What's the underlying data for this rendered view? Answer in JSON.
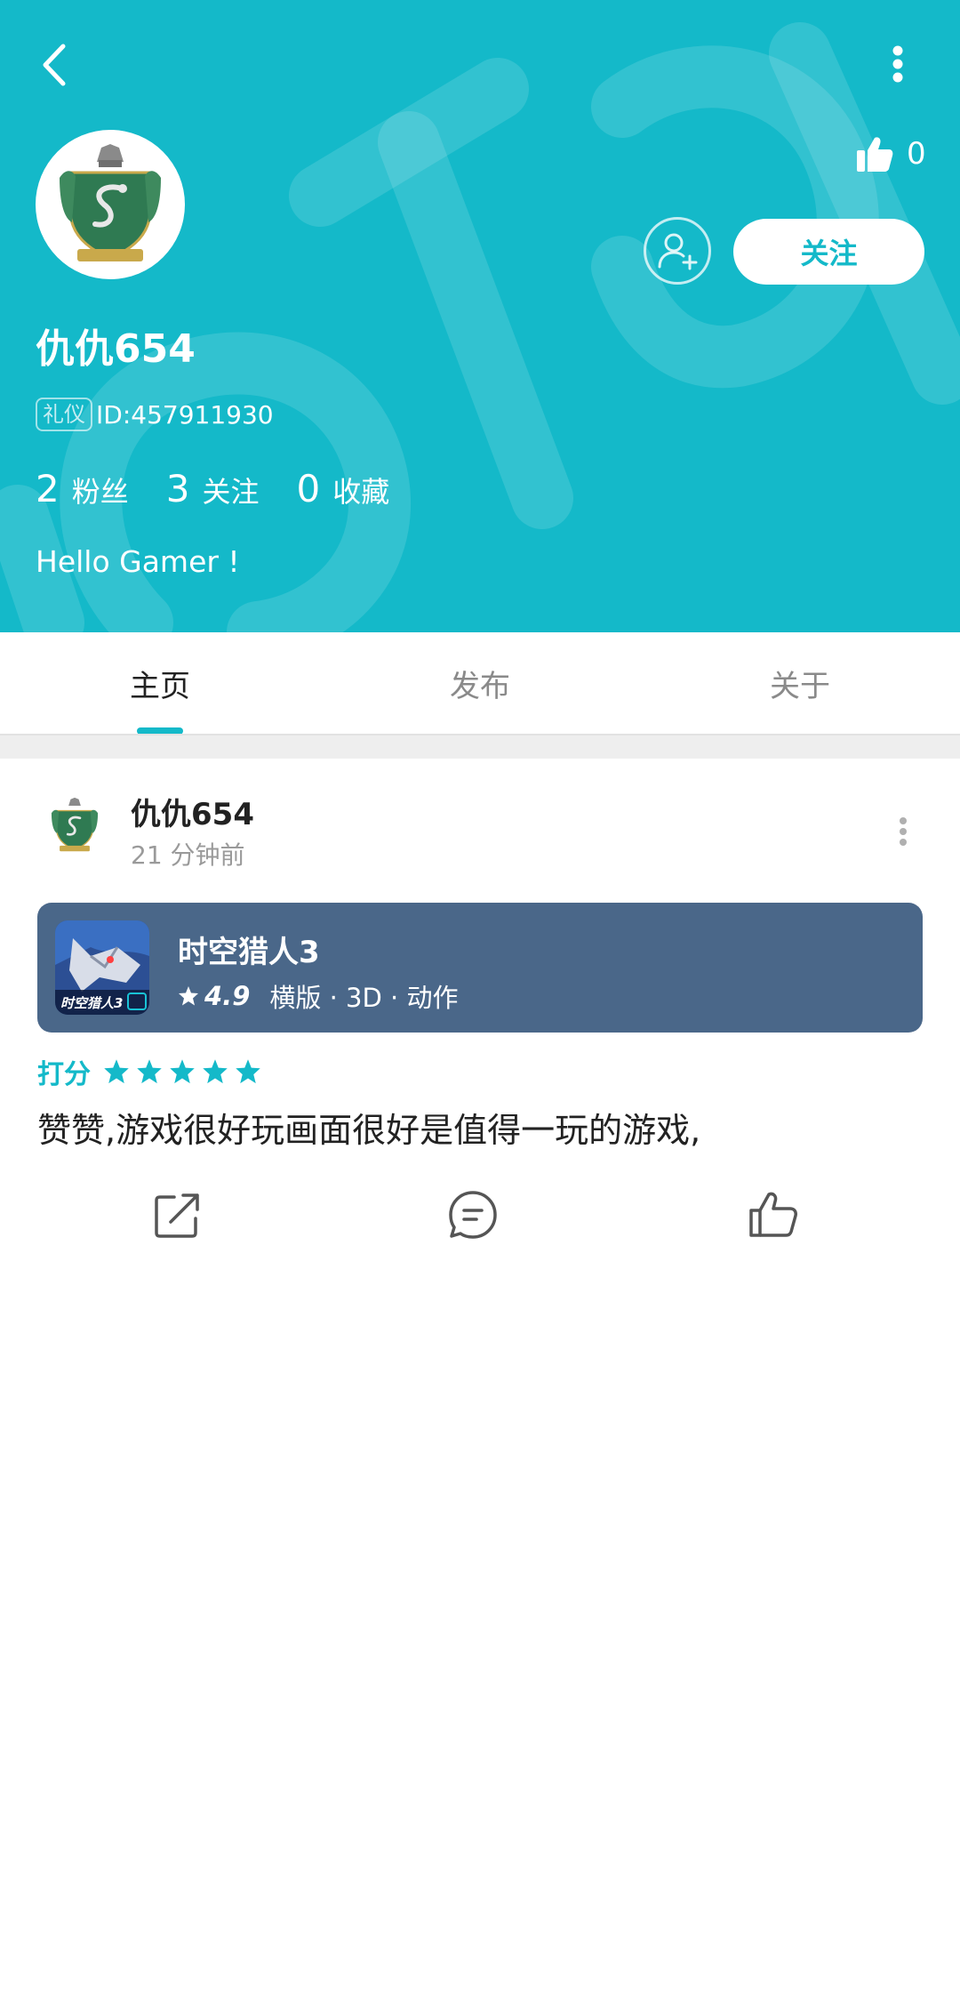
{
  "header": {
    "back_icon": "chevron-left-icon",
    "more_icon": "vertical-dots-icon",
    "like_icon": "thumbs-up-filled-icon",
    "like_count": "0",
    "avatar_icon": "house-crest-icon",
    "add_friend_icon": "add-user-icon",
    "follow_label": "关注",
    "username": "仇仇654",
    "badge": "礼仪",
    "user_id": "ID:457911930",
    "stats": [
      {
        "num": "2",
        "label": "粉丝"
      },
      {
        "num": "3",
        "label": "关注"
      },
      {
        "num": "0",
        "label": "收藏"
      }
    ],
    "bio": "Hello Gamer !",
    "background_color": "#14b9c9"
  },
  "tabs": [
    {
      "label": "主页",
      "active": true
    },
    {
      "label": "发布",
      "active": false
    },
    {
      "label": "关于",
      "active": false
    }
  ],
  "post": {
    "author": "仇仇654",
    "time": "21 分钟前",
    "game": {
      "title": "时空猎人3",
      "rating": "4.9",
      "tags": "横版 · 3D · 动作",
      "icon_text": "时空猎人3",
      "card_color": "#4a6789"
    },
    "score_label": "打分",
    "stars": 5,
    "text": "赞赞,游戏很好玩画面很好是值得一玩的游戏,",
    "actions": [
      "share-icon",
      "comment-icon",
      "like-icon"
    ]
  },
  "accent_color": "#14b9c9"
}
